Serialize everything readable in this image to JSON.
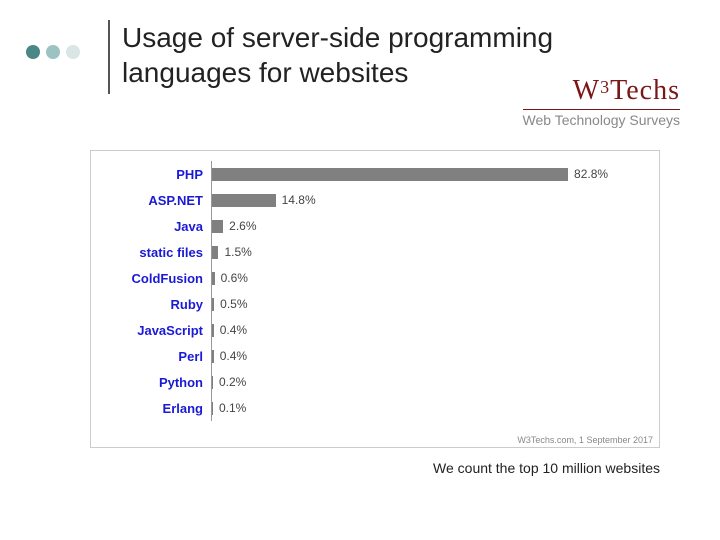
{
  "title": "Usage of server-side programming languages for websites",
  "brand": {
    "main_html_prefix": "W",
    "main_html_sup": "3",
    "main_html_suffix": "Techs",
    "sub": "Web Technology Surveys"
  },
  "chart_data": {
    "type": "bar",
    "orientation": "horizontal",
    "title": "Usage of server-side programming languages for websites",
    "xlabel": "",
    "ylabel": "",
    "xlim": [
      0,
      100
    ],
    "categories": [
      "PHP",
      "ASP.NET",
      "Java",
      "static files",
      "ColdFusion",
      "Ruby",
      "JavaScript",
      "Perl",
      "Python",
      "Erlang"
    ],
    "values": [
      82.8,
      14.8,
      2.6,
      1.5,
      0.6,
      0.5,
      0.4,
      0.4,
      0.2,
      0.1
    ],
    "value_labels": [
      "82.8%",
      "14.8%",
      "2.6%",
      "1.5%",
      "0.6%",
      "0.5%",
      "0.4%",
      "0.4%",
      "0.2%",
      "0.1%"
    ],
    "source": "W3Techs.com, 1 September 2017"
  },
  "footnote": "We count the top 10 million websites"
}
